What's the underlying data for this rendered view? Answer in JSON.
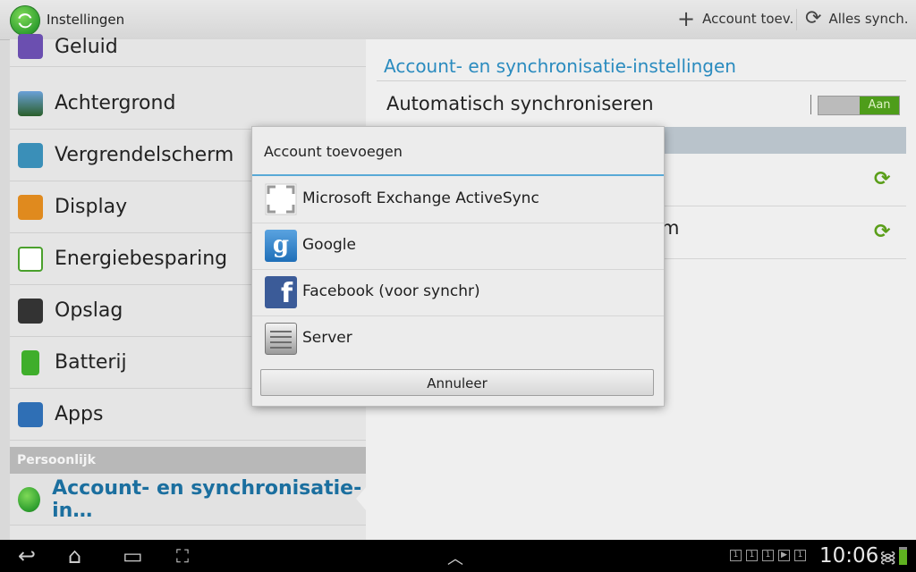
{
  "actionbar": {
    "title": "Instellingen",
    "add_account": "Account toev.",
    "sync_all": "Alles synch."
  },
  "left_items": [
    {
      "label": "Geluid",
      "icon": "speaker-icon"
    },
    {
      "label": "Achtergrond",
      "icon": "wallpaper-icon"
    },
    {
      "label": "Vergrendelscherm",
      "icon": "lock-icon"
    },
    {
      "label": "Display",
      "icon": "display-icon"
    },
    {
      "label": "Energiebesparing",
      "icon": "power-saving-icon"
    },
    {
      "label": "Opslag",
      "icon": "storage-icon"
    },
    {
      "label": "Batterij",
      "icon": "battery-icon"
    },
    {
      "label": "Apps",
      "icon": "apps-icon"
    }
  ],
  "section_personal": "Persoonlijk",
  "selected_item": "Account- en synchronisatie-in…",
  "right_panel": {
    "title": "Account- en synchronisatie-instellingen",
    "auto_sync_label": "Automatisch synchroniseren",
    "toggle_state": "Aan",
    "row2_partial": "m"
  },
  "dialog": {
    "title": "Account toevoegen",
    "items": [
      {
        "label": "Microsoft Exchange ActiveSync",
        "icon": "exchange-icon"
      },
      {
        "label": "Google",
        "icon": "google-icon"
      },
      {
        "label": "Facebook (voor synchr)",
        "icon": "facebook-icon"
      },
      {
        "label": "Server",
        "icon": "server-icon"
      }
    ],
    "cancel": "Annuleer"
  },
  "statusbar": {
    "time": "10:06"
  },
  "colors": {
    "accent_blue": "#2a8bbf",
    "selected_blue": "#1b6f9f",
    "toggle_green": "#4e9d1a",
    "dialog_divider": "#58a9d6"
  }
}
